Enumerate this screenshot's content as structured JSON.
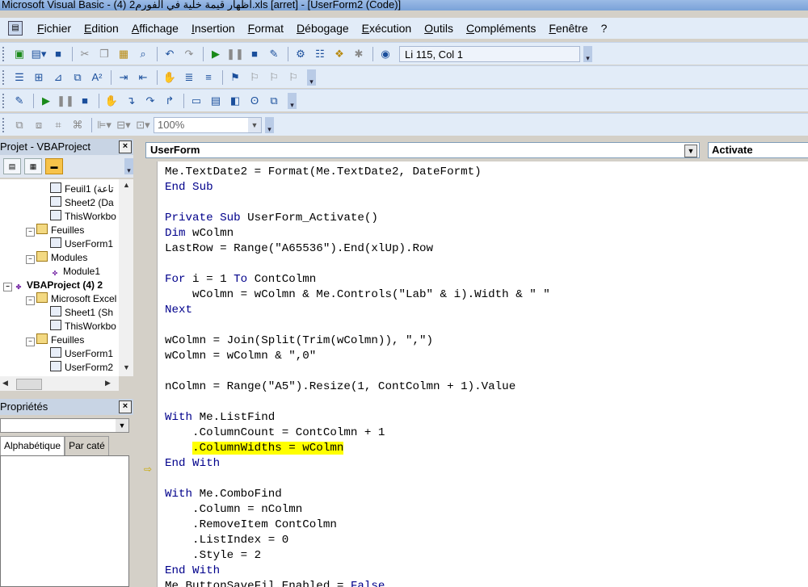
{
  "window": {
    "title": "Microsoft Visual Basic - (4) 2اظهار قيمة خلية في الفورم.xls [arret] - [UserForm2 (Code)]"
  },
  "menu": {
    "items": [
      "Fichier",
      "Edition",
      "Affichage",
      "Insertion",
      "Format",
      "Débogage",
      "Exécution",
      "Outils",
      "Compléments",
      "Fenêtre",
      "?"
    ]
  },
  "toolbar": {
    "position_text": "Li 115, Col 1",
    "zoom": "100%"
  },
  "project": {
    "title": "Projet - VBAProject",
    "tree": [
      {
        "label": "Feuil1 (تاعة",
        "type": "sheet"
      },
      {
        "label": "Sheet2 (Da",
        "type": "sheet"
      },
      {
        "label": "ThisWorkbo",
        "type": "workbook"
      },
      {
        "label": "Feuilles",
        "type": "folder"
      },
      {
        "label": "UserForm1",
        "type": "form"
      },
      {
        "label": "Modules",
        "type": "folder"
      },
      {
        "label": "Module1",
        "type": "module"
      },
      {
        "label": "VBAProject (4) 2",
        "type": "project"
      },
      {
        "label": "Microsoft Excel",
        "type": "folder"
      },
      {
        "label": "Sheet1 (Sh",
        "type": "sheet"
      },
      {
        "label": "ThisWorkbo",
        "type": "workbook"
      },
      {
        "label": "Feuilles",
        "type": "folder"
      },
      {
        "label": "UserForm1",
        "type": "form"
      },
      {
        "label": "UserForm2",
        "type": "form"
      }
    ]
  },
  "properties": {
    "title": "Propriétés",
    "tabs": [
      "Alphabétique",
      "Par caté"
    ]
  },
  "code": {
    "object_combo": "UserForm",
    "proc_combo": "Activate",
    "lines": [
      {
        "segments": [
          {
            "t": "Me.TextDate2 = Format(Me.TextDate2, DateFormt)",
            "c": "n"
          }
        ]
      },
      {
        "segments": [
          {
            "t": "End Sub",
            "c": "k"
          }
        ]
      },
      {
        "segments": []
      },
      {
        "segments": [
          {
            "t": "Private Sub",
            "c": "k"
          },
          {
            "t": " UserForm_Activate()",
            "c": "n"
          }
        ]
      },
      {
        "segments": [
          {
            "t": "Dim",
            "c": "k"
          },
          {
            "t": " wColmn",
            "c": "n"
          }
        ]
      },
      {
        "segments": [
          {
            "t": "LastRow = Range(\"A65536\").End(xlUp).Row",
            "c": "n"
          }
        ]
      },
      {
        "segments": []
      },
      {
        "segments": [
          {
            "t": "For",
            "c": "k"
          },
          {
            "t": " i = 1 ",
            "c": "n"
          },
          {
            "t": "To",
            "c": "k"
          },
          {
            "t": " ContColmn",
            "c": "n"
          }
        ]
      },
      {
        "segments": [
          {
            "t": "    wColmn = wColmn & Me.Controls(\"Lab\" & i).Width & \" \"",
            "c": "n"
          }
        ]
      },
      {
        "segments": [
          {
            "t": "Next",
            "c": "k"
          }
        ]
      },
      {
        "segments": []
      },
      {
        "segments": [
          {
            "t": "wColmn = Join(Split(Trim(wColmn)), \",\")",
            "c": "n"
          }
        ]
      },
      {
        "segments": [
          {
            "t": "wColmn = wColmn & \",0\"",
            "c": "n"
          }
        ]
      },
      {
        "segments": []
      },
      {
        "segments": [
          {
            "t": "nColmn = Range(\"A5\").Resize(1, ContColmn + 1).Value",
            "c": "n"
          }
        ]
      },
      {
        "segments": []
      },
      {
        "segments": [
          {
            "t": "With",
            "c": "k"
          },
          {
            "t": " Me.ListFind",
            "c": "n"
          }
        ]
      },
      {
        "segments": [
          {
            "t": "    .ColumnCount = ContColmn + 1",
            "c": "n"
          }
        ]
      },
      {
        "segments": [
          {
            "t": "    ",
            "c": "n"
          },
          {
            "t": ".ColumnWidths = wColmn",
            "c": "h"
          }
        ]
      },
      {
        "segments": [
          {
            "t": "End With",
            "c": "k"
          }
        ]
      },
      {
        "segments": []
      },
      {
        "segments": [
          {
            "t": "With",
            "c": "k"
          },
          {
            "t": " Me.ComboFind",
            "c": "n"
          }
        ]
      },
      {
        "segments": [
          {
            "t": "    .Column = nColmn",
            "c": "n"
          }
        ]
      },
      {
        "segments": [
          {
            "t": "    .RemoveItem ContColmn",
            "c": "n"
          }
        ]
      },
      {
        "segments": [
          {
            "t": "    .ListIndex = 0",
            "c": "n"
          }
        ]
      },
      {
        "segments": [
          {
            "t": "    .Style = 2",
            "c": "n"
          }
        ]
      },
      {
        "segments": [
          {
            "t": "End With",
            "c": "k"
          }
        ]
      },
      {
        "segments": [
          {
            "t": "Me.ButtonSaveFil.Enabled = ",
            "c": "n"
          },
          {
            "t": "False",
            "c": "k"
          }
        ]
      }
    ]
  }
}
